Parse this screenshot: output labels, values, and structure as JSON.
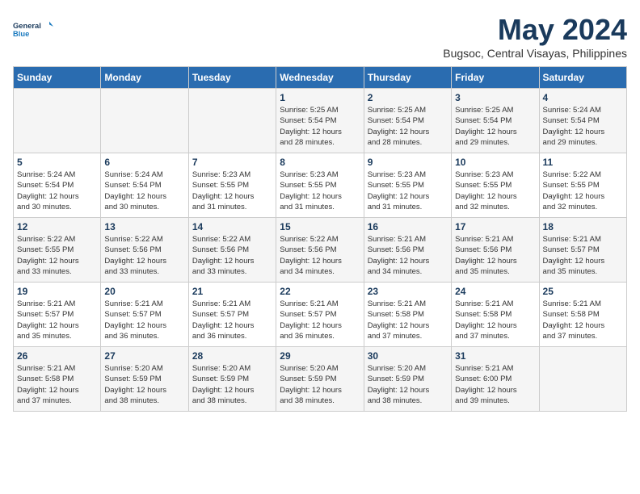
{
  "header": {
    "logo_line1": "General",
    "logo_line2": "Blue",
    "month": "May 2024",
    "location": "Bugsoc, Central Visayas, Philippines"
  },
  "weekdays": [
    "Sunday",
    "Monday",
    "Tuesday",
    "Wednesday",
    "Thursday",
    "Friday",
    "Saturday"
  ],
  "weeks": [
    [
      {
        "day": "",
        "info": ""
      },
      {
        "day": "",
        "info": ""
      },
      {
        "day": "",
        "info": ""
      },
      {
        "day": "1",
        "info": "Sunrise: 5:25 AM\nSunset: 5:54 PM\nDaylight: 12 hours\nand 28 minutes."
      },
      {
        "day": "2",
        "info": "Sunrise: 5:25 AM\nSunset: 5:54 PM\nDaylight: 12 hours\nand 28 minutes."
      },
      {
        "day": "3",
        "info": "Sunrise: 5:25 AM\nSunset: 5:54 PM\nDaylight: 12 hours\nand 29 minutes."
      },
      {
        "day": "4",
        "info": "Sunrise: 5:24 AM\nSunset: 5:54 PM\nDaylight: 12 hours\nand 29 minutes."
      }
    ],
    [
      {
        "day": "5",
        "info": "Sunrise: 5:24 AM\nSunset: 5:54 PM\nDaylight: 12 hours\nand 30 minutes."
      },
      {
        "day": "6",
        "info": "Sunrise: 5:24 AM\nSunset: 5:54 PM\nDaylight: 12 hours\nand 30 minutes."
      },
      {
        "day": "7",
        "info": "Sunrise: 5:23 AM\nSunset: 5:55 PM\nDaylight: 12 hours\nand 31 minutes."
      },
      {
        "day": "8",
        "info": "Sunrise: 5:23 AM\nSunset: 5:55 PM\nDaylight: 12 hours\nand 31 minutes."
      },
      {
        "day": "9",
        "info": "Sunrise: 5:23 AM\nSunset: 5:55 PM\nDaylight: 12 hours\nand 31 minutes."
      },
      {
        "day": "10",
        "info": "Sunrise: 5:23 AM\nSunset: 5:55 PM\nDaylight: 12 hours\nand 32 minutes."
      },
      {
        "day": "11",
        "info": "Sunrise: 5:22 AM\nSunset: 5:55 PM\nDaylight: 12 hours\nand 32 minutes."
      }
    ],
    [
      {
        "day": "12",
        "info": "Sunrise: 5:22 AM\nSunset: 5:55 PM\nDaylight: 12 hours\nand 33 minutes."
      },
      {
        "day": "13",
        "info": "Sunrise: 5:22 AM\nSunset: 5:56 PM\nDaylight: 12 hours\nand 33 minutes."
      },
      {
        "day": "14",
        "info": "Sunrise: 5:22 AM\nSunset: 5:56 PM\nDaylight: 12 hours\nand 33 minutes."
      },
      {
        "day": "15",
        "info": "Sunrise: 5:22 AM\nSunset: 5:56 PM\nDaylight: 12 hours\nand 34 minutes."
      },
      {
        "day": "16",
        "info": "Sunrise: 5:21 AM\nSunset: 5:56 PM\nDaylight: 12 hours\nand 34 minutes."
      },
      {
        "day": "17",
        "info": "Sunrise: 5:21 AM\nSunset: 5:56 PM\nDaylight: 12 hours\nand 35 minutes."
      },
      {
        "day": "18",
        "info": "Sunrise: 5:21 AM\nSunset: 5:57 PM\nDaylight: 12 hours\nand 35 minutes."
      }
    ],
    [
      {
        "day": "19",
        "info": "Sunrise: 5:21 AM\nSunset: 5:57 PM\nDaylight: 12 hours\nand 35 minutes."
      },
      {
        "day": "20",
        "info": "Sunrise: 5:21 AM\nSunset: 5:57 PM\nDaylight: 12 hours\nand 36 minutes."
      },
      {
        "day": "21",
        "info": "Sunrise: 5:21 AM\nSunset: 5:57 PM\nDaylight: 12 hours\nand 36 minutes."
      },
      {
        "day": "22",
        "info": "Sunrise: 5:21 AM\nSunset: 5:57 PM\nDaylight: 12 hours\nand 36 minutes."
      },
      {
        "day": "23",
        "info": "Sunrise: 5:21 AM\nSunset: 5:58 PM\nDaylight: 12 hours\nand 37 minutes."
      },
      {
        "day": "24",
        "info": "Sunrise: 5:21 AM\nSunset: 5:58 PM\nDaylight: 12 hours\nand 37 minutes."
      },
      {
        "day": "25",
        "info": "Sunrise: 5:21 AM\nSunset: 5:58 PM\nDaylight: 12 hours\nand 37 minutes."
      }
    ],
    [
      {
        "day": "26",
        "info": "Sunrise: 5:21 AM\nSunset: 5:58 PM\nDaylight: 12 hours\nand 37 minutes."
      },
      {
        "day": "27",
        "info": "Sunrise: 5:20 AM\nSunset: 5:59 PM\nDaylight: 12 hours\nand 38 minutes."
      },
      {
        "day": "28",
        "info": "Sunrise: 5:20 AM\nSunset: 5:59 PM\nDaylight: 12 hours\nand 38 minutes."
      },
      {
        "day": "29",
        "info": "Sunrise: 5:20 AM\nSunset: 5:59 PM\nDaylight: 12 hours\nand 38 minutes."
      },
      {
        "day": "30",
        "info": "Sunrise: 5:20 AM\nSunset: 5:59 PM\nDaylight: 12 hours\nand 38 minutes."
      },
      {
        "day": "31",
        "info": "Sunrise: 5:21 AM\nSunset: 6:00 PM\nDaylight: 12 hours\nand 39 minutes."
      },
      {
        "day": "",
        "info": ""
      }
    ]
  ]
}
